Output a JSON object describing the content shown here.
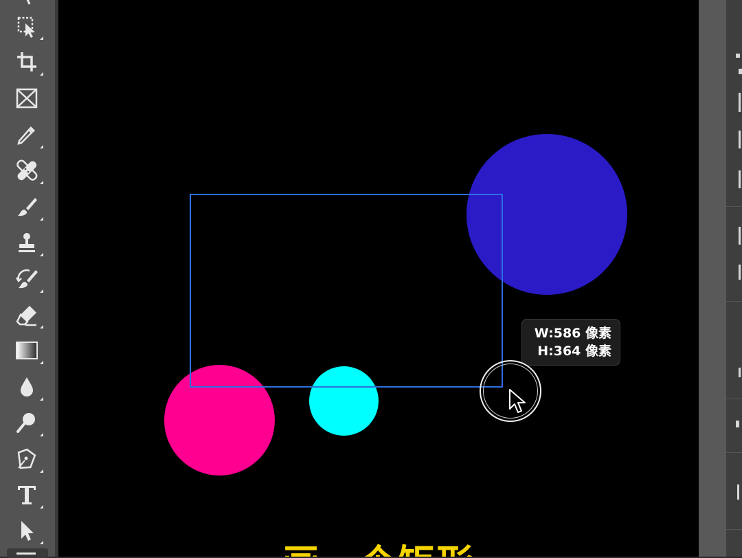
{
  "app": {
    "toolbar": {
      "tools": [
        {
          "name": "object-selection-icon"
        },
        {
          "name": "crop-icon"
        },
        {
          "name": "frame-icon"
        },
        {
          "name": "eyedropper-icon"
        },
        {
          "name": "healing-brush-icon"
        },
        {
          "name": "brush-icon"
        },
        {
          "name": "clone-stamp-icon"
        },
        {
          "name": "history-brush-icon"
        },
        {
          "name": "eraser-icon"
        },
        {
          "name": "gradient-icon"
        },
        {
          "name": "blur-icon"
        },
        {
          "name": "dodge-icon"
        },
        {
          "name": "pen-icon"
        },
        {
          "name": "type-icon"
        },
        {
          "name": "path-selection-icon"
        }
      ]
    }
  },
  "canvas": {
    "background": "#000000",
    "shapes": [
      {
        "name": "blue-circle",
        "color": "#2a1bc7"
      },
      {
        "name": "magenta-circle",
        "color": "#ff0090"
      },
      {
        "name": "cyan-circle",
        "color": "#00ffff"
      }
    ],
    "selection_color": "#2f6fe0"
  },
  "tooltip": {
    "width_line": "W:586 像素",
    "height_line": "H:364 像素"
  },
  "caption": {
    "text": "画一个矩形",
    "color": "#f5d400"
  }
}
